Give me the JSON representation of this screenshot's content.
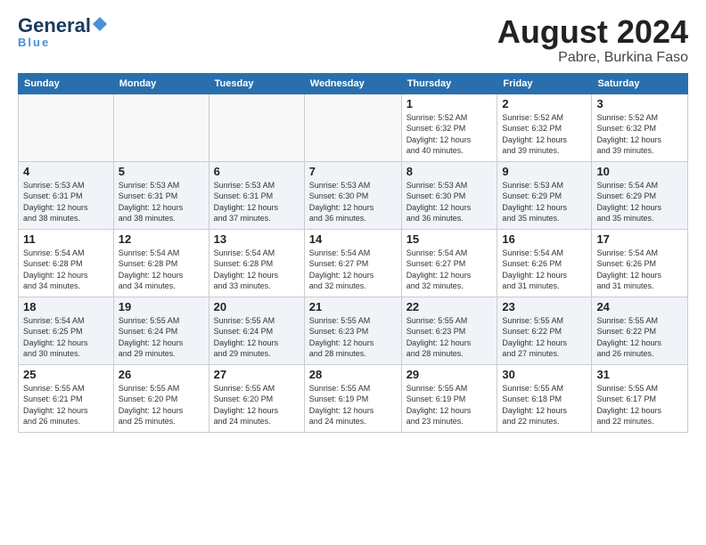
{
  "header": {
    "logo_main": "General",
    "logo_sub": "Blue",
    "tagline": "Blue",
    "title": "August 2024",
    "subtitle": "Pabre, Burkina Faso"
  },
  "weekdays": [
    "Sunday",
    "Monday",
    "Tuesday",
    "Wednesday",
    "Thursday",
    "Friday",
    "Saturday"
  ],
  "weeks": [
    [
      {
        "day": "",
        "info": ""
      },
      {
        "day": "",
        "info": ""
      },
      {
        "day": "",
        "info": ""
      },
      {
        "day": "",
        "info": ""
      },
      {
        "day": "1",
        "info": "Sunrise: 5:52 AM\nSunset: 6:32 PM\nDaylight: 12 hours\nand 40 minutes."
      },
      {
        "day": "2",
        "info": "Sunrise: 5:52 AM\nSunset: 6:32 PM\nDaylight: 12 hours\nand 39 minutes."
      },
      {
        "day": "3",
        "info": "Sunrise: 5:52 AM\nSunset: 6:32 PM\nDaylight: 12 hours\nand 39 minutes."
      }
    ],
    [
      {
        "day": "4",
        "info": "Sunrise: 5:53 AM\nSunset: 6:31 PM\nDaylight: 12 hours\nand 38 minutes."
      },
      {
        "day": "5",
        "info": "Sunrise: 5:53 AM\nSunset: 6:31 PM\nDaylight: 12 hours\nand 38 minutes."
      },
      {
        "day": "6",
        "info": "Sunrise: 5:53 AM\nSunset: 6:31 PM\nDaylight: 12 hours\nand 37 minutes."
      },
      {
        "day": "7",
        "info": "Sunrise: 5:53 AM\nSunset: 6:30 PM\nDaylight: 12 hours\nand 36 minutes."
      },
      {
        "day": "8",
        "info": "Sunrise: 5:53 AM\nSunset: 6:30 PM\nDaylight: 12 hours\nand 36 minutes."
      },
      {
        "day": "9",
        "info": "Sunrise: 5:53 AM\nSunset: 6:29 PM\nDaylight: 12 hours\nand 35 minutes."
      },
      {
        "day": "10",
        "info": "Sunrise: 5:54 AM\nSunset: 6:29 PM\nDaylight: 12 hours\nand 35 minutes."
      }
    ],
    [
      {
        "day": "11",
        "info": "Sunrise: 5:54 AM\nSunset: 6:28 PM\nDaylight: 12 hours\nand 34 minutes."
      },
      {
        "day": "12",
        "info": "Sunrise: 5:54 AM\nSunset: 6:28 PM\nDaylight: 12 hours\nand 34 minutes."
      },
      {
        "day": "13",
        "info": "Sunrise: 5:54 AM\nSunset: 6:28 PM\nDaylight: 12 hours\nand 33 minutes."
      },
      {
        "day": "14",
        "info": "Sunrise: 5:54 AM\nSunset: 6:27 PM\nDaylight: 12 hours\nand 32 minutes."
      },
      {
        "day": "15",
        "info": "Sunrise: 5:54 AM\nSunset: 6:27 PM\nDaylight: 12 hours\nand 32 minutes."
      },
      {
        "day": "16",
        "info": "Sunrise: 5:54 AM\nSunset: 6:26 PM\nDaylight: 12 hours\nand 31 minutes."
      },
      {
        "day": "17",
        "info": "Sunrise: 5:54 AM\nSunset: 6:26 PM\nDaylight: 12 hours\nand 31 minutes."
      }
    ],
    [
      {
        "day": "18",
        "info": "Sunrise: 5:54 AM\nSunset: 6:25 PM\nDaylight: 12 hours\nand 30 minutes."
      },
      {
        "day": "19",
        "info": "Sunrise: 5:55 AM\nSunset: 6:24 PM\nDaylight: 12 hours\nand 29 minutes."
      },
      {
        "day": "20",
        "info": "Sunrise: 5:55 AM\nSunset: 6:24 PM\nDaylight: 12 hours\nand 29 minutes."
      },
      {
        "day": "21",
        "info": "Sunrise: 5:55 AM\nSunset: 6:23 PM\nDaylight: 12 hours\nand 28 minutes."
      },
      {
        "day": "22",
        "info": "Sunrise: 5:55 AM\nSunset: 6:23 PM\nDaylight: 12 hours\nand 28 minutes."
      },
      {
        "day": "23",
        "info": "Sunrise: 5:55 AM\nSunset: 6:22 PM\nDaylight: 12 hours\nand 27 minutes."
      },
      {
        "day": "24",
        "info": "Sunrise: 5:55 AM\nSunset: 6:22 PM\nDaylight: 12 hours\nand 26 minutes."
      }
    ],
    [
      {
        "day": "25",
        "info": "Sunrise: 5:55 AM\nSunset: 6:21 PM\nDaylight: 12 hours\nand 26 minutes."
      },
      {
        "day": "26",
        "info": "Sunrise: 5:55 AM\nSunset: 6:20 PM\nDaylight: 12 hours\nand 25 minutes."
      },
      {
        "day": "27",
        "info": "Sunrise: 5:55 AM\nSunset: 6:20 PM\nDaylight: 12 hours\nand 24 minutes."
      },
      {
        "day": "28",
        "info": "Sunrise: 5:55 AM\nSunset: 6:19 PM\nDaylight: 12 hours\nand 24 minutes."
      },
      {
        "day": "29",
        "info": "Sunrise: 5:55 AM\nSunset: 6:19 PM\nDaylight: 12 hours\nand 23 minutes."
      },
      {
        "day": "30",
        "info": "Sunrise: 5:55 AM\nSunset: 6:18 PM\nDaylight: 12 hours\nand 22 minutes."
      },
      {
        "day": "31",
        "info": "Sunrise: 5:55 AM\nSunset: 6:17 PM\nDaylight: 12 hours\nand 22 minutes."
      }
    ]
  ]
}
